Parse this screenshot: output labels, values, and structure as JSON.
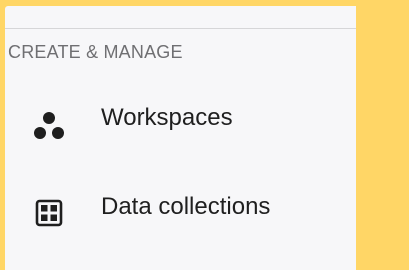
{
  "section": {
    "label": "CREATE & MANAGE"
  },
  "nav": {
    "items": [
      {
        "label": "Workspaces",
        "icon": "workspaces-icon"
      },
      {
        "label": "Data collections",
        "icon": "data-collections-icon"
      }
    ]
  },
  "colors": {
    "background": "#ffd666",
    "panel": "#f7f7f9",
    "text": "#1f1f1f",
    "section_label": "#6f6f72"
  }
}
